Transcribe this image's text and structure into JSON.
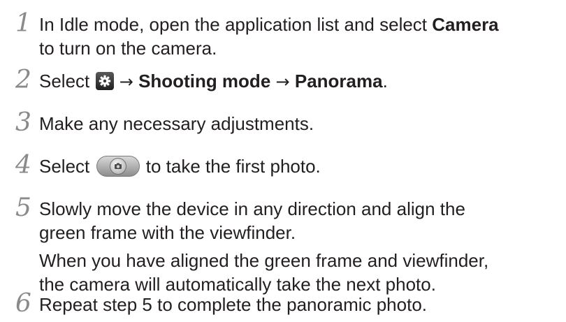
{
  "steps": [
    {
      "number": "1",
      "line1_prefix": "In Idle mode, open the application list and select ",
      "line1_bold": "Camera",
      "line2": "to turn on the camera."
    },
    {
      "number": "2",
      "prefix": "Select",
      "arrow1": "→",
      "bold1": "Shooting mode",
      "arrow2": "→",
      "bold2": "Panorama",
      "suffix": "."
    },
    {
      "number": "3",
      "text": "Make any necessary adjustments."
    },
    {
      "number": "4",
      "prefix": "Select",
      "suffix": "to take the first photo."
    },
    {
      "number": "5",
      "lines": [
        "Slowly move the device in any direction and align the",
        "green frame with the viewfinder.",
        "When you have aligned the green frame and viewfinder,",
        "the camera will automatically take the next photo."
      ]
    },
    {
      "number": "6",
      "text": "Repeat step 5 to complete the panoramic photo."
    }
  ],
  "icons": {
    "settings": "gear-icon",
    "shutter": "camera-shutter-icon"
  }
}
